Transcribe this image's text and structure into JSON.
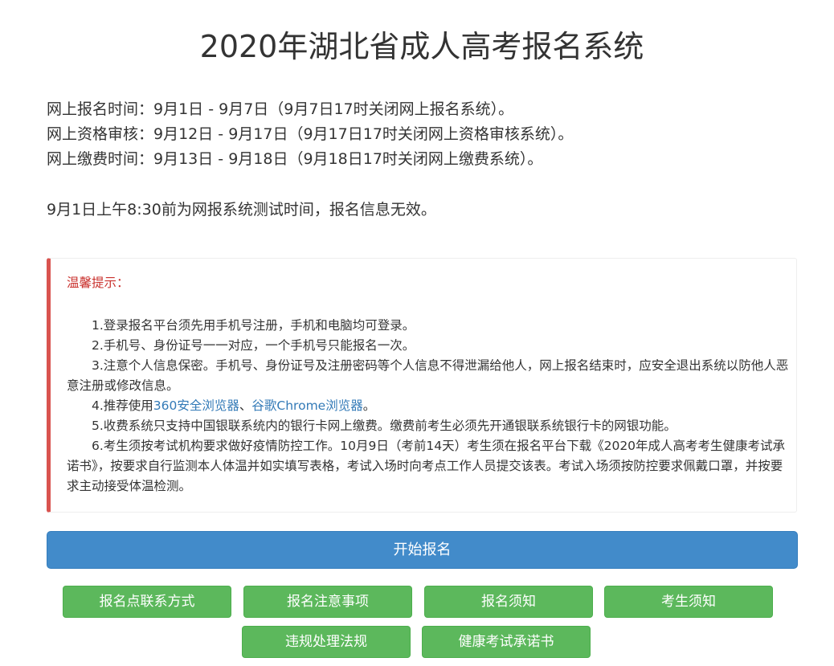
{
  "header": {
    "title": "2020年湖北省成人高考报名系统"
  },
  "schedule": {
    "lines": [
      "网上报名时间：9月1日 - 9月7日（9月7日17时关闭网上报名系统）。",
      "网上资格审核：9月12日 - 9月17日（9月17日17时关闭网上资格审核系统）。",
      "网上缴费时间：9月13日 - 9月18日（9月18日17时关闭网上缴费系统）。"
    ],
    "test_notice": "9月1日上午8:30前为网报系统测试时间，报名信息无效。"
  },
  "tips": {
    "title": "温馨提示：",
    "item1": "1.登录报名平台须先用手机号注册，手机和电脑均可登录。",
    "item2": "2.手机号、身份证号一一对应，一个手机号只能报名一次。",
    "item3": "3.注意个人信息保密。手机号、身份证号及注册密码等个人信息不得泄漏给他人，网上报名结束时，应安全退出系统以防他人恶意注册或修改信息。",
    "item4_prefix": "4.推荐使用",
    "item4_link1": "360安全浏览器",
    "item4_sep": "、",
    "item4_link2": "谷歌Chrome浏览器",
    "item4_suffix": "。",
    "item5": "5.收费系统只支持中国银联系统内的银行卡网上缴费。缴费前考生必须先开通银联系统银行卡的网银功能。",
    "item6": "6.考生须按考试机构要求做好疫情防控工作。10月9日（考前14天）考生须在报名平台下载《2020年成人高考考生健康考试承诺书》，按要求自行监测本人体温并如实填写表格，考试入场时向考点工作人员提交该表。考试入场须按防控要求佩戴口罩，并按要求主动接受体温检测。"
  },
  "actions": {
    "start_label": "开始报名",
    "contact_label": "报名点联系方式",
    "precautions_label": "报名注意事项",
    "registration_guide_label": "报名须知",
    "candidate_guide_label": "考生须知",
    "violations_label": "违规处理法规",
    "health_pledge_label": "健康考试承诺书"
  },
  "colors": {
    "primary": "#428bca",
    "success": "#5cb85c",
    "danger": "#d9534f",
    "link": "#337ab7"
  }
}
